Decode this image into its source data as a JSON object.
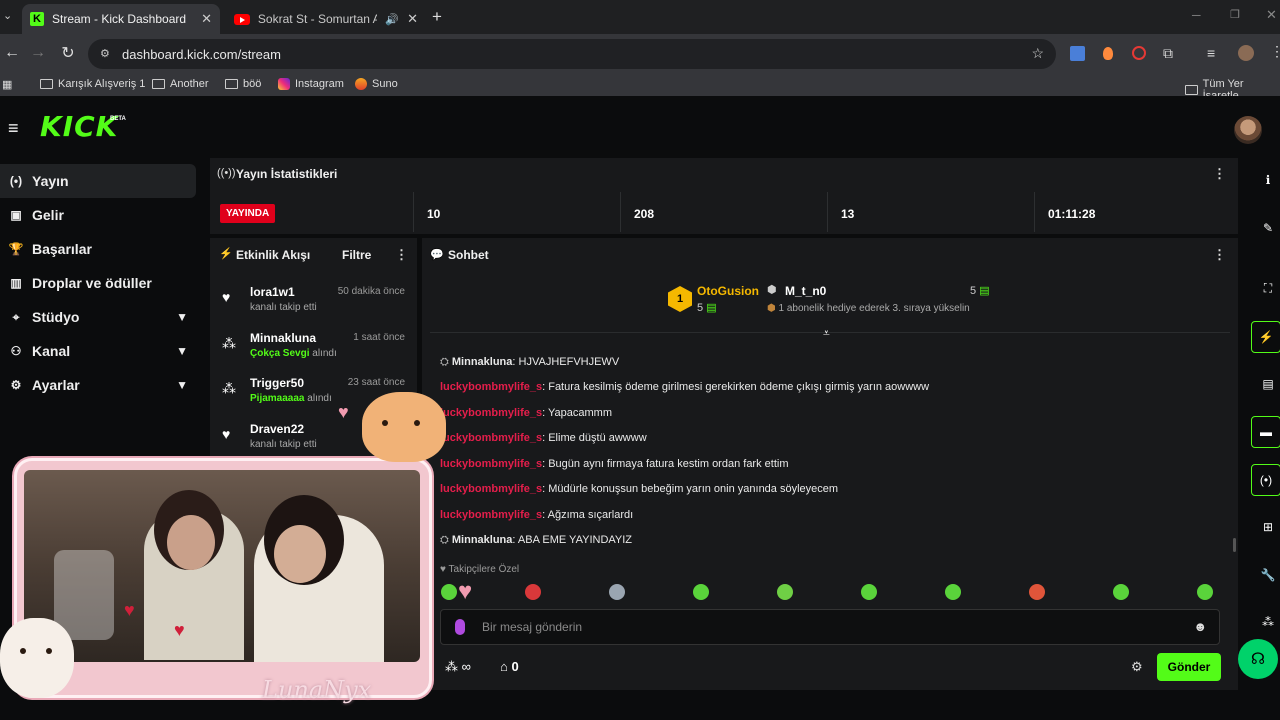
{
  "browser": {
    "tabs": [
      {
        "title": "Stream - Kick Dashboard"
      },
      {
        "title": "Sokrat St - Somurtan Adam"
      }
    ],
    "new_tab": "+",
    "url": "dashboard.kick.com/stream",
    "bookmarks": [
      "Karışık Alışveriş 1",
      "Another",
      "böö",
      "Instagram",
      "Suno"
    ],
    "all_bookmarks": "Tüm Yer İşaretle"
  },
  "kick": {
    "logo": "KICK",
    "beta": "BETA"
  },
  "sidebar": {
    "items": [
      {
        "label": "Yayın",
        "icon": "broadcast-icon"
      },
      {
        "label": "Gelir",
        "icon": "revenue-icon"
      },
      {
        "label": "Başarılar",
        "icon": "trophy-icon"
      },
      {
        "label": "Droplar ve ödüller",
        "icon": "gift-icon"
      },
      {
        "label": "Stüdyo",
        "icon": "studio-icon"
      },
      {
        "label": "Kanal",
        "icon": "channel-icon"
      },
      {
        "label": "Ayarlar",
        "icon": "gear-icon"
      }
    ]
  },
  "stats": {
    "title": "Yayın İstatistikleri",
    "live_badge": "YAYINDA",
    "values": [
      "10",
      "208",
      "13",
      "01:11:28"
    ]
  },
  "activity": {
    "title": "Etkinlik Akışı",
    "filter": "Filtre",
    "events": [
      {
        "name": "lora1w1",
        "time": "50 dakika önce",
        "pre": "",
        "highlight": "",
        "action": "kanalı takip etti"
      },
      {
        "name": "Minnakluna",
        "time": "1 saat önce",
        "pre": "",
        "highlight": "Çokça Sevgi",
        "action": "alındı"
      },
      {
        "name": "Trigger50",
        "time": "23 saat önce",
        "pre": "",
        "highlight": "Pijamaaaaa",
        "action": "alındı"
      },
      {
        "name": "Draven22",
        "time": "1 g",
        "pre": "",
        "highlight": "",
        "action": "kanalı takip etti"
      }
    ]
  },
  "chat": {
    "title": "Sohbet",
    "pinned": {
      "leader_rank": "1",
      "leader_name": "OtoGusion",
      "leader_count": "5",
      "gifter_name": "M_t_n0",
      "gifter_count": "5",
      "gifter_note": "1 abonelik hediye ederek 3. sıraya yükselin"
    },
    "messages": [
      {
        "user": "Minnakluna",
        "text": "HJVAJHEFVHJEWV",
        "style": "u2"
      },
      {
        "user": "luckybombmylife_s",
        "text": "Fatura kesilmiş ödeme girilmesi gerekirken ödeme çıkışı girmiş yarın aowwww",
        "style": "u"
      },
      {
        "user": "luckybombmylife_s",
        "text": "Yapacammm",
        "style": "u"
      },
      {
        "user": "luckybombmylife_s",
        "text": "Elime düştü awwww",
        "style": "u"
      },
      {
        "user": "luckybombmylife_s",
        "text": "Bugün aynı firmaya fatura kestim ordan fark ettim",
        "style": "u"
      },
      {
        "user": "luckybombmylife_s",
        "text": "Müdürle konuşsun bebeğim yarın onin yanında söyleyecem",
        "style": "u"
      },
      {
        "user": "luckybombmylife_s",
        "text": "Ağzıma sıçarlardı",
        "style": "u"
      },
      {
        "user": "Minnakluna",
        "text": "ABA EME YAYINDAYIZ",
        "style": "u2"
      }
    ],
    "followers_only": "Takipçilere Özel",
    "emote_colors": [
      "#5ad33b",
      "#d9383a",
      "#9aa5b1",
      "#5ad33b",
      "#6fcf45",
      "#5ad33b",
      "#5ad33b",
      "#e0553a",
      "#5ad33b",
      "#5ad33b"
    ],
    "input_placeholder": "Bir mesaj gönderin",
    "points": "∞",
    "store_count": "0",
    "send": "Gönder"
  },
  "overlay": {
    "signature": "LunaNyx"
  }
}
